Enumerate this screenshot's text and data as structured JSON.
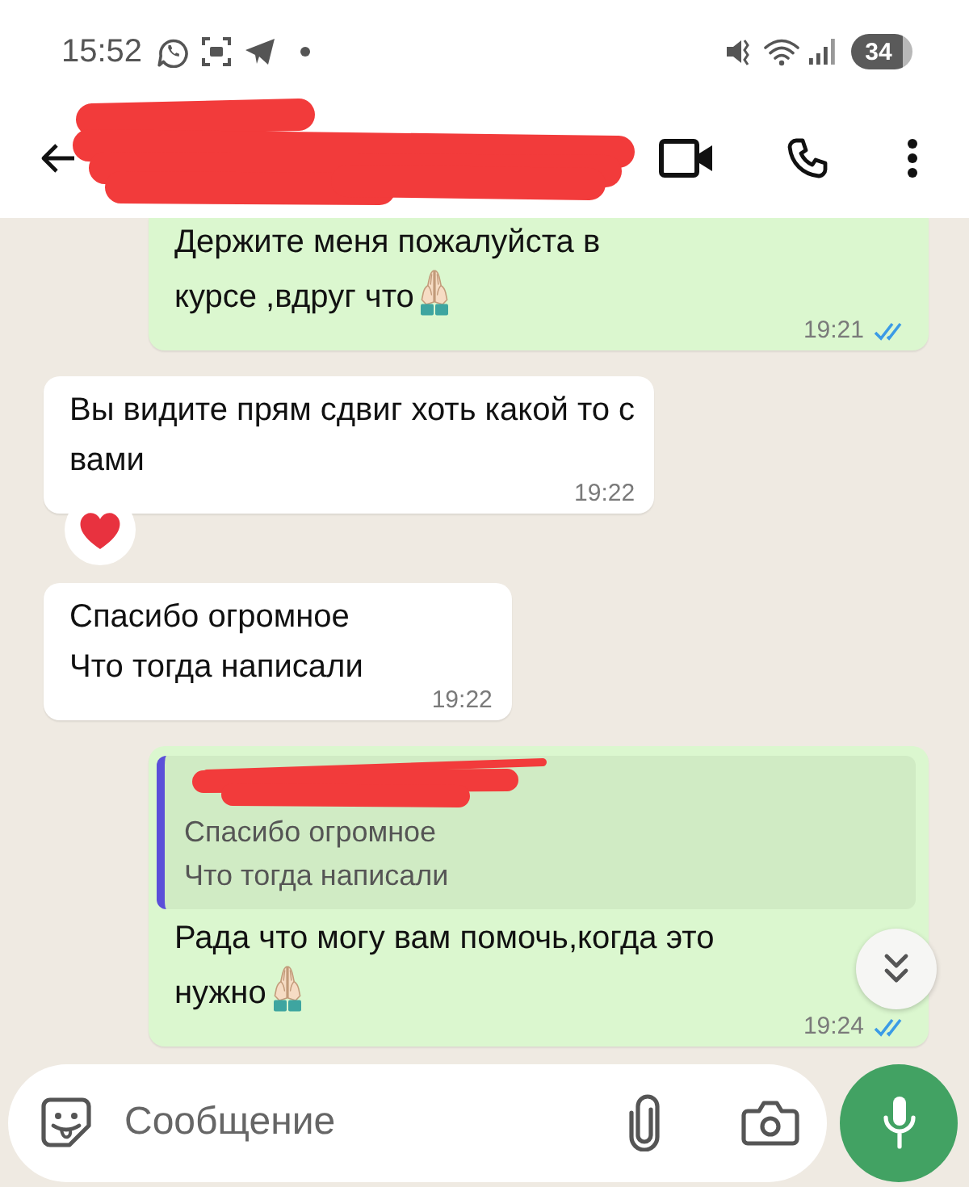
{
  "status_bar": {
    "time": "15:52",
    "battery": "34"
  },
  "messages": [
    {
      "kind": "outgoing",
      "text": "Держите меня пожалуйста в\nкурсе ,вдруг что",
      "emoji": true,
      "reaction": false,
      "time": "19:21",
      "read": true
    },
    {
      "kind": "incoming",
      "text": "Вы видите прям сдвиг хоть какой то с\nвами",
      "emoji": false,
      "reaction": true,
      "time": "19:22"
    },
    {
      "kind": "incoming",
      "text": "Спасибо огромное\nЧто тогда написали",
      "emoji": false,
      "reaction": false,
      "time": "19:22"
    },
    {
      "kind": "outgoing",
      "quote": {
        "text": "Спасибо огромное\nЧто тогда написали"
      },
      "text": "Рада что могу вам помочь,когда это\nнужно",
      "emoji": true,
      "reaction": false,
      "time": "19:24",
      "read": true
    }
  ],
  "composer": {
    "placeholder": "Сообщение"
  }
}
